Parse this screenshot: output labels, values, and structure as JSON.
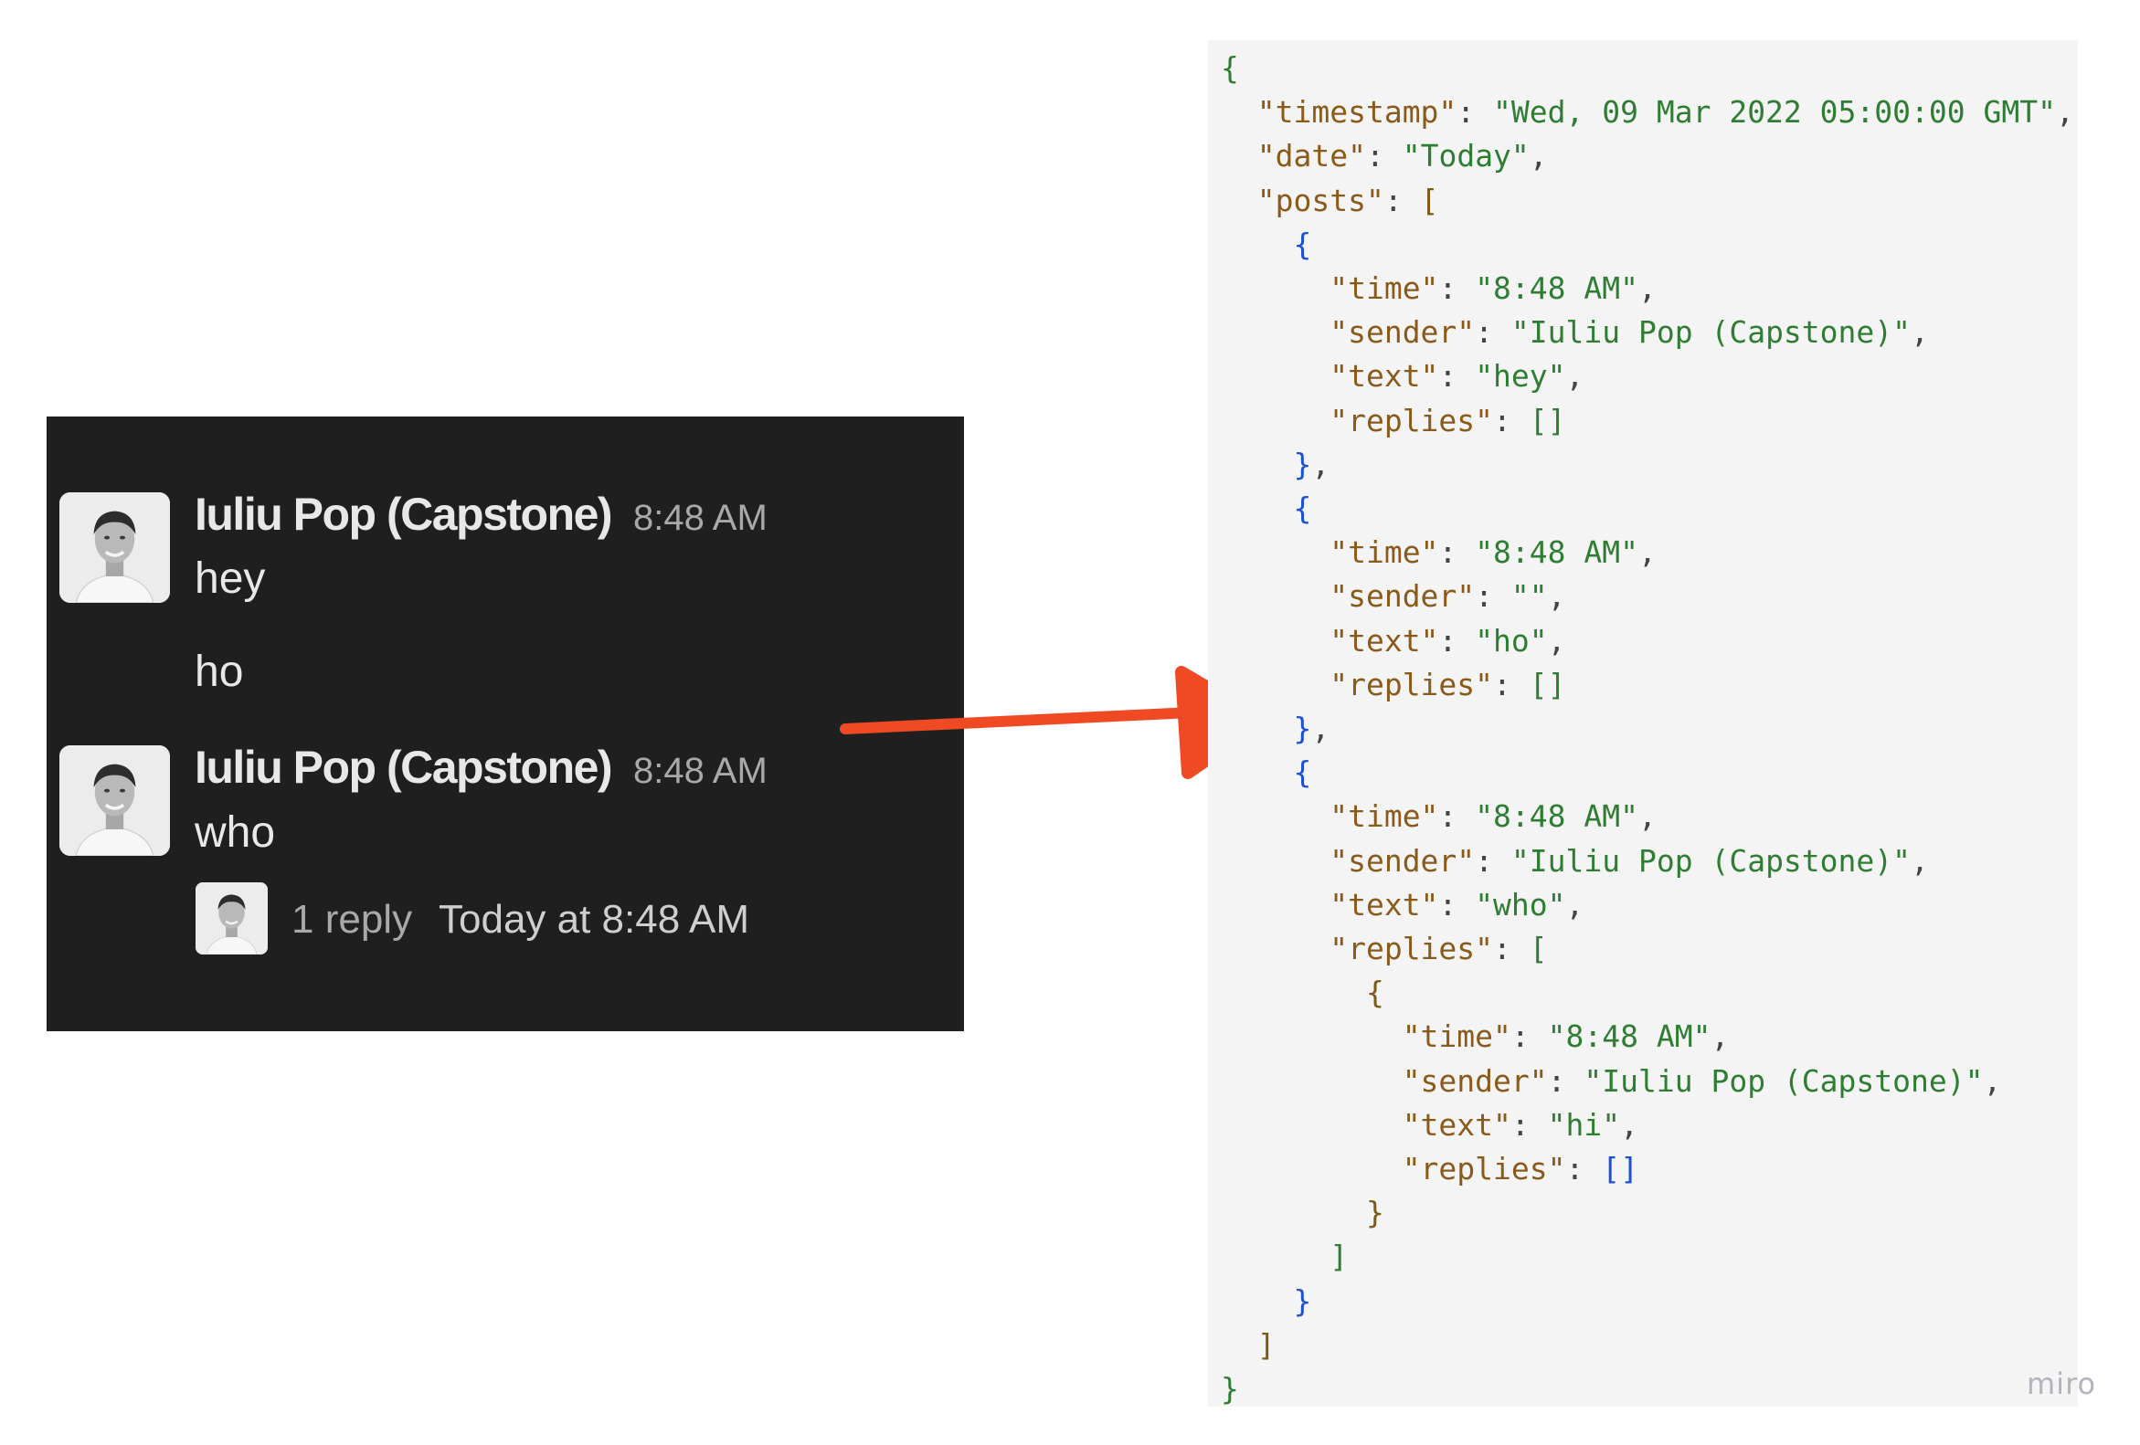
{
  "chat": {
    "messages": [
      {
        "sender": "Iuliu Pop (Capstone)",
        "time": "8:48 AM",
        "lines": [
          "hey",
          "ho"
        ]
      },
      {
        "sender": "Iuliu Pop (Capstone)",
        "time": "8:48 AM",
        "lines": [
          "who"
        ],
        "thread": {
          "reply_count": "1 reply",
          "last_reply": "Today at 8:48 AM"
        }
      }
    ]
  },
  "json_lines": [
    "{",
    "  \"timestamp\": \"Wed, 09 Mar 2022 05:00:00 GMT\",",
    "  \"date\": \"Today\",",
    "  \"posts\": [",
    "    {",
    "      \"time\": \"8:48 AM\",",
    "      \"sender\": \"Iuliu Pop (Capstone)\",",
    "      \"text\": \"hey\",",
    "      \"replies\": []",
    "    },",
    "    {",
    "      \"time\": \"8:48 AM\",",
    "      \"sender\": \"\",",
    "      \"text\": \"ho\",",
    "      \"replies\": []",
    "    },",
    "    {",
    "      \"time\": \"8:48 AM\",",
    "      \"sender\": \"Iuliu Pop (Capstone)\",",
    "      \"text\": \"who\",",
    "      \"replies\": [",
    "        {",
    "          \"time\": \"8:48 AM\",",
    "          \"sender\": \"Iuliu Pop (Capstone)\",",
    "          \"text\": \"hi\",",
    "          \"replies\": []",
    "        }",
    "      ]",
    "    }",
    "  ]",
    "}"
  ],
  "watermark": "miro",
  "colors": {
    "arrow": "#f04a24",
    "chat_background": "#1f1f20",
    "code_background": "#f4f4f4"
  }
}
